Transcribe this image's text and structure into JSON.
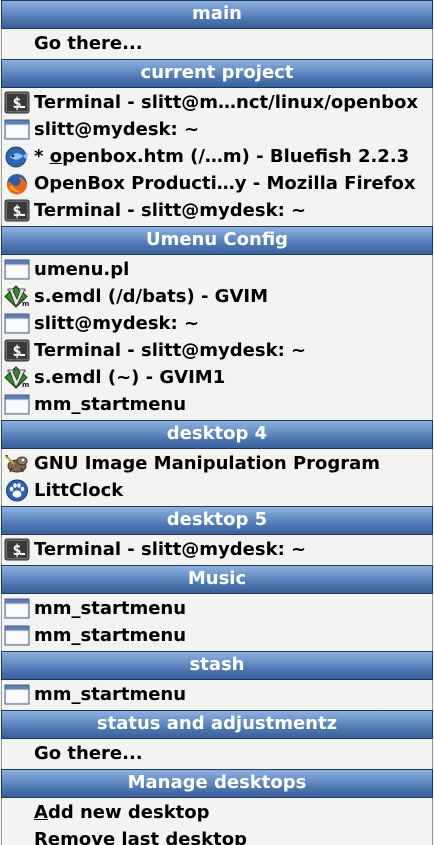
{
  "menu": {
    "sections": [
      {
        "header": "main",
        "items": [
          {
            "icon": "none",
            "label": "Go there..."
          }
        ]
      },
      {
        "header": "current project",
        "items": [
          {
            "icon": "terminal-icon",
            "label": "Terminal - slitt@m…nct/linux/openbox"
          },
          {
            "icon": "window-icon",
            "label": "slitt@mydesk: ~"
          },
          {
            "icon": "bluefish-icon",
            "label_prefix": "* ",
            "label_underline": "o",
            "label_rest": "penbox.htm (/…m) - Bluefish 2.2.3"
          },
          {
            "icon": "firefox-icon",
            "label": "OpenBox Producti…y - Mozilla Firefox"
          },
          {
            "icon": "terminal-icon",
            "label": "Terminal - slitt@mydesk: ~"
          }
        ]
      },
      {
        "header": "Umenu Config",
        "items": [
          {
            "icon": "window-icon",
            "label": "umenu.pl"
          },
          {
            "icon": "gvim-icon",
            "label": "s.emdl (/d/bats) - GVIM"
          },
          {
            "icon": "window-icon",
            "label": "slitt@mydesk: ~"
          },
          {
            "icon": "terminal-icon",
            "label": "Terminal - slitt@mydesk: ~"
          },
          {
            "icon": "gvim-icon",
            "label": "s.emdl (~) - GVIM1"
          },
          {
            "icon": "window-icon",
            "label": "mm_startmenu"
          }
        ]
      },
      {
        "header": "desktop 4",
        "items": [
          {
            "icon": "gimp-icon",
            "label": "GNU Image Manipulation Program"
          },
          {
            "icon": "pawprint-icon",
            "label": "LittClock"
          }
        ]
      },
      {
        "header": "desktop 5",
        "items": [
          {
            "icon": "terminal-icon",
            "label": "Terminal - slitt@mydesk: ~"
          }
        ]
      },
      {
        "header": "Music",
        "items": [
          {
            "icon": "window-icon",
            "label": "mm_startmenu"
          },
          {
            "icon": "window-icon",
            "label": "mm_startmenu"
          }
        ]
      },
      {
        "header": "stash",
        "items": [
          {
            "icon": "window-icon",
            "label": "mm_startmenu"
          }
        ]
      },
      {
        "header": "status and adjustmentz",
        "items": [
          {
            "icon": "none",
            "label": "Go there..."
          }
        ]
      },
      {
        "header": "Manage desktops",
        "items": [
          {
            "icon": "none",
            "label_underline": "A",
            "label_rest": "dd new desktop"
          },
          {
            "icon": "none",
            "label_underline": "R",
            "label_rest": "emove last desktop"
          }
        ]
      }
    ]
  },
  "colors": {
    "header_top": "#8db0de",
    "header_bottom": "#395f99",
    "background": "#f3f3f2",
    "text": "#000000",
    "header_text": "#ffffff"
  }
}
